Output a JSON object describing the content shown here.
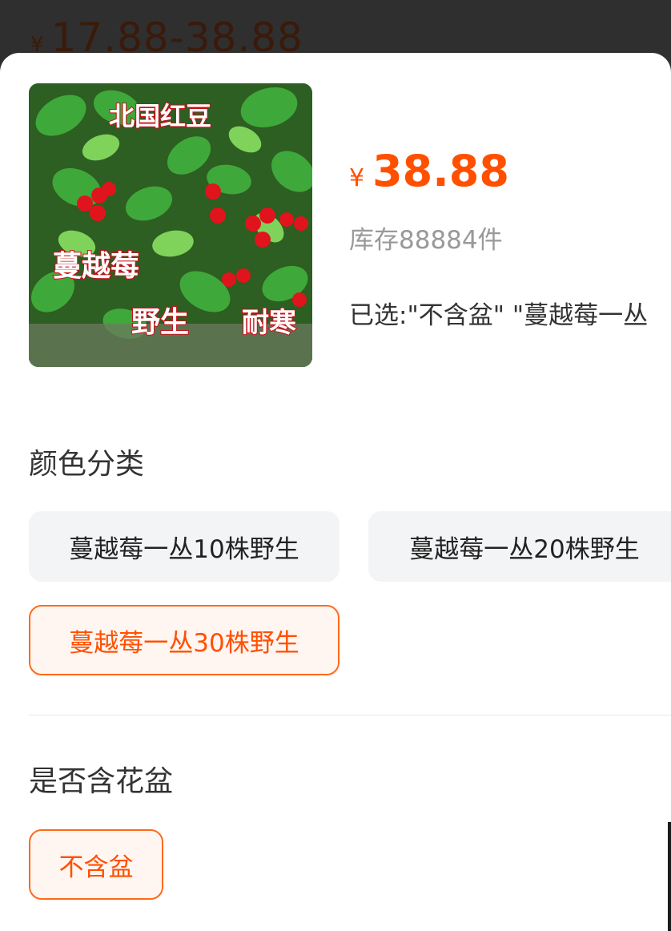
{
  "background": {
    "price_range": "17.88-38.88",
    "currency_symbol": "¥"
  },
  "product": {
    "image_alt": "蔓越莓 product photo",
    "image_overlay_texts": [
      "北国红豆",
      "蔓越莓",
      "野生",
      "耐寒"
    ],
    "currency_symbol": "¥",
    "price": "38.88",
    "stock_text": "库存88884件",
    "selected_text": "已选:\"不含盆\" \"蔓越莓一丛"
  },
  "sections": {
    "color": {
      "title": "颜色分类",
      "options": [
        {
          "label": "蔓越莓一丛10株野生",
          "state": "normal"
        },
        {
          "label": "蔓越莓一丛20株野生",
          "state": "normal"
        },
        {
          "label": "蔓越莓一丛30株野生",
          "state": "selected"
        }
      ]
    },
    "pot": {
      "title": "是否含花盆",
      "options": [
        {
          "label": "不含盆",
          "state": "selected"
        }
      ]
    }
  },
  "colors": {
    "accent": "#ff5000",
    "chip_bg": "#f3f4f6",
    "selected_chip_bg": "#fff6f2",
    "overlay": "#2f2f2f"
  }
}
